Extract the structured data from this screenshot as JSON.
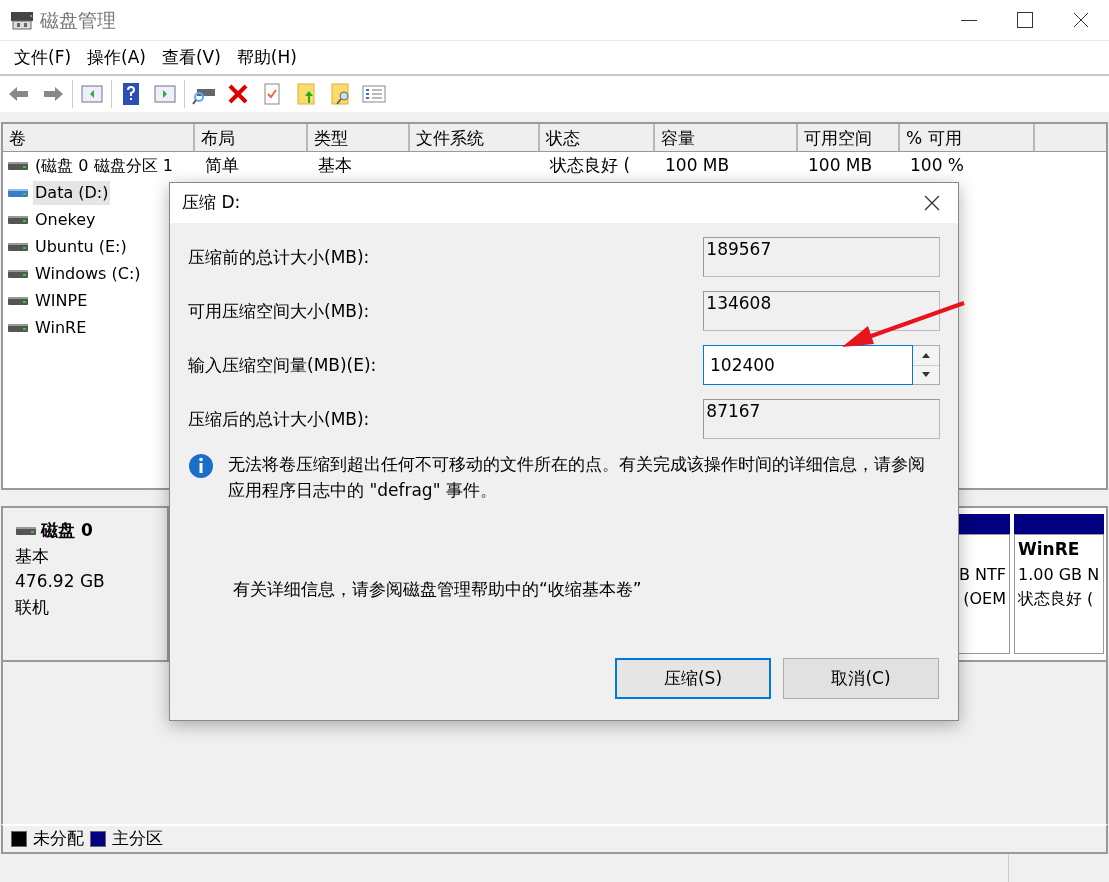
{
  "window": {
    "title": "磁盘管理"
  },
  "menu": [
    "文件(F)",
    "操作(A)",
    "查看(V)",
    "帮助(H)"
  ],
  "table": {
    "columns": [
      "卷",
      "布局",
      "类型",
      "文件系统",
      "状态",
      "容量",
      "可用空间",
      "% 可用"
    ],
    "rows": [
      {
        "cells": [
          "(磁盘 0 磁盘分区 1",
          "简单",
          "基本",
          "",
          "状态良好 (",
          "100 MB",
          "100 MB",
          "100 %"
        ],
        "selected": false
      },
      {
        "cells": [
          "Data (D:)"
        ],
        "selected": true
      },
      {
        "cells": [
          "Onekey"
        ],
        "selected": false
      },
      {
        "cells": [
          "Ubuntu (E:)"
        ],
        "selected": false
      },
      {
        "cells": [
          "Windows (C:)"
        ],
        "selected": false
      },
      {
        "cells": [
          "WINPE"
        ],
        "selected": false
      },
      {
        "cells": [
          "WinRE"
        ],
        "selected": false
      }
    ]
  },
  "disk": {
    "name": "磁盘 0",
    "type": "基本",
    "size": "476.92 GB",
    "status": "联机",
    "partitions": [
      {
        "lines": [
          "B NTF",
          "(OEM"
        ]
      },
      {
        "name": "WinRE",
        "lines": [
          "1.00 GB N",
          "状态良好 ("
        ]
      }
    ]
  },
  "legend": [
    {
      "label": "未分配",
      "color": "#000000"
    },
    {
      "label": "主分区",
      "color": "#000080"
    }
  ],
  "dialog": {
    "title": "压缩 D:",
    "fields": [
      {
        "label": "压缩前的总计大小(MB):",
        "value": "189567",
        "kind": "readonly"
      },
      {
        "label": "可用压缩空间大小(MB):",
        "value": "134608",
        "kind": "readonly"
      },
      {
        "label": "输入压缩空间量(MB)(E):",
        "value": "102400",
        "kind": "spin"
      },
      {
        "label": "压缩后的总计大小(MB):",
        "value": "87167",
        "kind": "readonly"
      }
    ],
    "info": "无法将卷压缩到超出任何不可移动的文件所在的点。有关完成该操作时间的详细信息，请参阅应用程序日志中的 \"defrag\" 事件。",
    "help": "有关详细信息，请参阅磁盘管理帮助中的“收缩基本卷”",
    "buttons": [
      {
        "label": "压缩(S)",
        "default": true
      },
      {
        "label": "取消(C)",
        "default": false
      }
    ]
  }
}
